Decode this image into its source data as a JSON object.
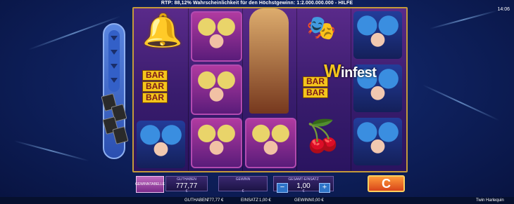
{
  "header": {
    "rtp_text": "RTP: 88,12% Wahrscheinlichkeit für den Höchstgewinn: 1:2.000.000.000 - HILFE",
    "clock": "14:06"
  },
  "reels": {
    "logo_prefix": "in",
    "logo_suffix": "fest",
    "bar_label": "BAR"
  },
  "controls": {
    "paytable_label": "GEWINNTABELLE",
    "balance_label": "GUTHABEN",
    "balance_value": "777,77",
    "balance_unit": "€",
    "win_label": "GEWINN",
    "win_unit": "€",
    "total_bet_label": "GESAMT-EINSATZ",
    "total_bet_value": "1,00",
    "total_bet_unit": "€",
    "minus": "−",
    "plus": "+",
    "spin_symbol": "C"
  },
  "status": {
    "balance_label": "GUTHABEN",
    "balance_value": "777,77 €",
    "bet_label": "EINSATZ",
    "bet_value": "1,00 €",
    "win_label": "GEWINN",
    "win_value": "0,00 €",
    "game_name": "Twin Harlequin"
  }
}
